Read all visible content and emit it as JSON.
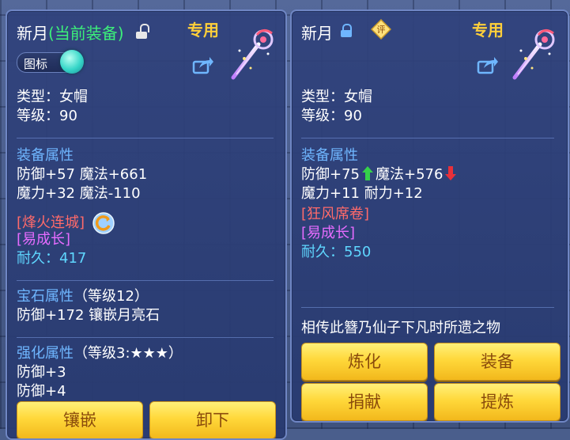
{
  "left": {
    "name": "新月",
    "equipped_tag": "(当前装备)",
    "special_label": "专用",
    "icon_toggle_label": "图标",
    "type_line": "类型：女帽",
    "level_line": "等级：90",
    "attr_header": "装备属性",
    "attr_line1": "防御+57 魔法+661",
    "attr_line2": "魔力+32 魔法-110",
    "skill": "[烽火连城]",
    "trait": "[易成长]",
    "durability_label": "耐久：",
    "durability_value": "417",
    "gem_header": "宝石属性",
    "gem_level": "（等级12）",
    "gem_line": "防御+172 镶嵌月亮石",
    "enhance_header": "强化属性",
    "enhance_level": "（等级3:★★★）",
    "enhance_line1": "防御+3",
    "enhance_line2": "防御+4",
    "buttons": {
      "inlay": "镶嵌",
      "remove": "卸下"
    }
  },
  "right": {
    "name": "新月",
    "special_label": "专用",
    "rate_label": "评",
    "type_line": "类型：女帽",
    "level_line": "等级：90",
    "attr_header": "装备属性",
    "attr_def": "防御+75",
    "attr_magic": "魔法+576",
    "attr_line2": "魔力+11 耐力+12",
    "skill": "[狂风席卷]",
    "trait": "[易成长]",
    "durability_label": "耐久：",
    "durability_value": "550",
    "description": "相传此簪乃仙子下凡时所遗之物",
    "buttons": {
      "refine": "炼化",
      "equip": "装备",
      "donate": "捐献",
      "extract": "提炼"
    }
  },
  "colors": {
    "equipped": "#3cf07a",
    "special": "#ffcf3a",
    "section": "#6fb6ff",
    "skill": "#ff6a6a",
    "trait": "#e66cff",
    "durability": "#5fd7ff",
    "up_arrow": "#35d24a",
    "down_arrow": "#e8303a"
  },
  "icons": [
    "unlock-icon",
    "lock-icon",
    "share-icon",
    "weapon-hairpin-icon",
    "rate-badge-icon",
    "refresh-icon",
    "arrow-up-icon",
    "arrow-down-icon"
  ]
}
